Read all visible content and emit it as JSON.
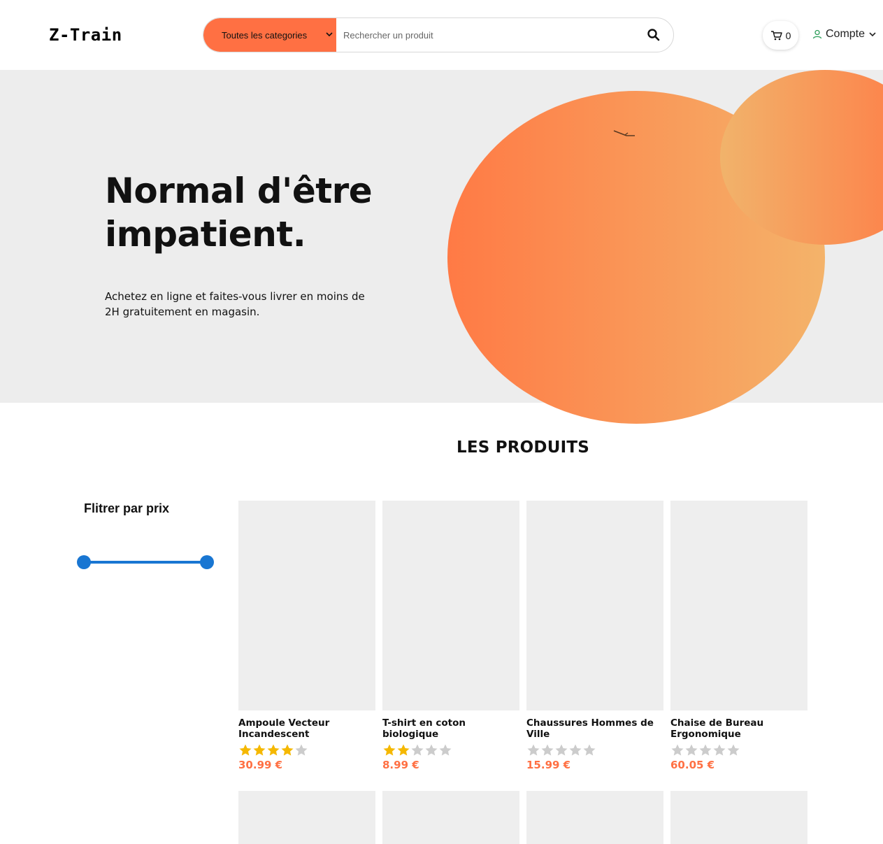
{
  "header": {
    "logo": "Z-Train",
    "category_select": "Toutes les categories",
    "search_placeholder": "Rechercher un produit",
    "cart_count": "0",
    "account_label": "Compte"
  },
  "hero": {
    "title": "Normal d'être\nimpatient.",
    "subtitle": "Achetez en ligne et faites-vous livrer en moins de 2H gratuitement en magasin."
  },
  "products_section": {
    "title": "LES PRODUITS",
    "filter_title": "Flitrer par prix"
  },
  "products": [
    {
      "name": "Ampoule Vecteur Incandescent",
      "rating": 4,
      "price": "30.99 €"
    },
    {
      "name": "T-shirt en coton biologique",
      "rating": 2,
      "price": "8.99 €"
    },
    {
      "name": "Chaussures Hommes de Ville",
      "rating": 0,
      "price": "15.99 €"
    },
    {
      "name": "Chaise de Bureau Ergonomique",
      "rating": 0,
      "price": "60.05 €"
    }
  ],
  "colors": {
    "accent": "#ff7043",
    "slider": "#1976d2",
    "star_filled": "#f5b800",
    "star_empty": "#cccccc",
    "hero_bg": "#ededed"
  },
  "icons": {
    "search": "search-icon",
    "cart": "cart-icon",
    "account": "user-icon",
    "chevron": "chevron-down-icon",
    "star": "star-icon"
  }
}
